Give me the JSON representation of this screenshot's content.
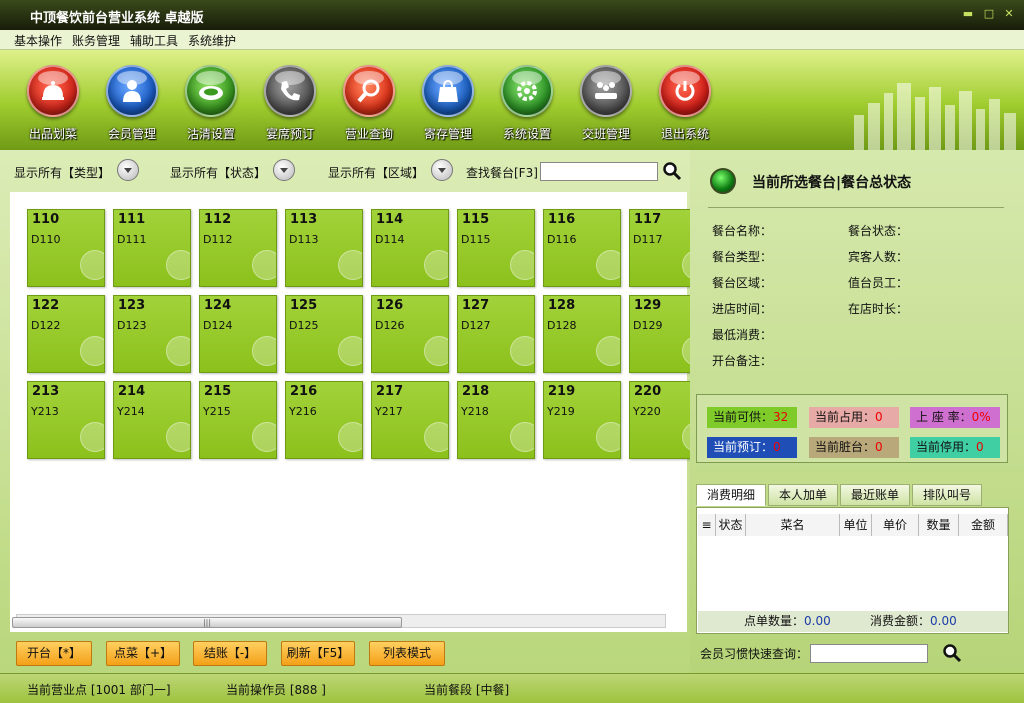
{
  "window": {
    "title": "中顶餐饮前台营业系统  卓越版"
  },
  "menu": [
    "基本操作",
    "账务管理",
    "辅助工具",
    "系统维护"
  ],
  "toolbar": [
    {
      "label": "出品划菜",
      "icon": "cloche-icon",
      "color": "#d8281c"
    },
    {
      "label": "会员管理",
      "icon": "member-icon",
      "color": "#1c5ec8"
    },
    {
      "label": "沽清设置",
      "icon": "plate-icon",
      "color": "#3a9a20"
    },
    {
      "label": "宴席预订",
      "icon": "phone-icon",
      "color": "#555555"
    },
    {
      "label": "营业查询",
      "icon": "magnifier-icon",
      "color": "#e0341a"
    },
    {
      "label": "寄存管理",
      "icon": "bag-icon",
      "color": "#1c62c4"
    },
    {
      "label": "系统设置",
      "icon": "gear-icon",
      "color": "#2f9a28"
    },
    {
      "label": "交班管理",
      "icon": "handover-icon",
      "color": "#555555"
    },
    {
      "label": "退出系统",
      "icon": "power-icon",
      "color": "#d8201a"
    }
  ],
  "filters": {
    "type": "显示所有【类型】",
    "status": "显示所有【状态】",
    "area": "显示所有【区域】",
    "search_label": "查找餐台[F3]"
  },
  "tables": [
    [
      {
        "no": "110",
        "code": "D110"
      },
      {
        "no": "111",
        "code": "D111"
      },
      {
        "no": "112",
        "code": "D112"
      },
      {
        "no": "113",
        "code": "D113"
      },
      {
        "no": "114",
        "code": "D114"
      },
      {
        "no": "115",
        "code": "D115"
      },
      {
        "no": "116",
        "code": "D116"
      },
      {
        "no": "117",
        "code": "D117"
      }
    ],
    [
      {
        "no": "122",
        "code": "D122"
      },
      {
        "no": "123",
        "code": "D123"
      },
      {
        "no": "124",
        "code": "D124"
      },
      {
        "no": "125",
        "code": "D125"
      },
      {
        "no": "126",
        "code": "D126"
      },
      {
        "no": "127",
        "code": "D127"
      },
      {
        "no": "128",
        "code": "D128"
      },
      {
        "no": "129",
        "code": "D129"
      }
    ],
    [
      {
        "no": "213",
        "code": "Y213"
      },
      {
        "no": "214",
        "code": "Y214"
      },
      {
        "no": "215",
        "code": "Y215"
      },
      {
        "no": "216",
        "code": "Y216"
      },
      {
        "no": "217",
        "code": "Y217"
      },
      {
        "no": "218",
        "code": "Y218"
      },
      {
        "no": "219",
        "code": "Y219"
      },
      {
        "no": "220",
        "code": "Y220"
      }
    ]
  ],
  "actions": {
    "open": "开台【*】",
    "order": "点菜【+】",
    "checkout": "结账【-】",
    "refresh": "刷新【F5】",
    "listmode": "列表模式"
  },
  "right": {
    "title": "当前所选餐台|餐台总状态",
    "info": {
      "name": "餐台名称：",
      "status": "餐台状态：",
      "type": "餐台类型：",
      "guests": "宾客人数：",
      "area": "餐台区域：",
      "staff": "值台员工：",
      "time_in": "进店时间：",
      "duration": "在店时长：",
      "min_spend": "最低消费：",
      "remark": "开台备注："
    },
    "stats": {
      "avail": {
        "label": "当前可供：",
        "value": "32",
        "bg": "#7ecb2a"
      },
      "occupied": {
        "label": "当前占用：",
        "value": "0",
        "bg": "#e8aaa6"
      },
      "rate": {
        "label": "上 座 率：",
        "value": "0%",
        "bg": "#cf6fcf"
      },
      "booked": {
        "label": "当前预订：",
        "value": "0",
        "bg": "#1f4fb6"
      },
      "dirty": {
        "label": "当前脏台：",
        "value": "0",
        "bg": "#b9a87a"
      },
      "disabled": {
        "label": "当前停用：",
        "value": "0",
        "bg": "#3fcfa2"
      }
    },
    "tabs": [
      "消费明细",
      "本人加单",
      "最近账单",
      "排队叫号"
    ],
    "grid_headers": [
      "状态",
      "菜名",
      "单位",
      "单价",
      "数量",
      "金额"
    ],
    "foot": {
      "count_label": "点单数量：",
      "count": "0.00",
      "amount_label": "消费金额：",
      "amount": "0.00"
    },
    "member_label": "会员习惯快速查询："
  },
  "status": {
    "point": "当前营业点 [1001 部门一]",
    "operator": "当前操作员 [888 ]",
    "meal": "当前餐段 [中餐]"
  }
}
